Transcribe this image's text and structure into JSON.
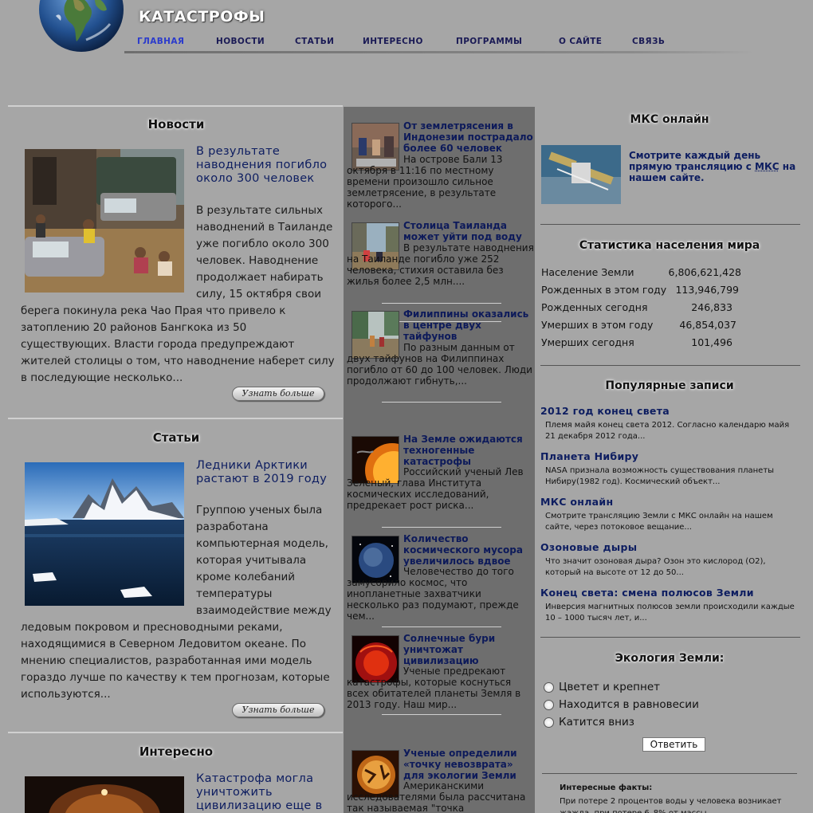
{
  "site": {
    "title": "КАТАСТРОФЫ"
  },
  "nav": [
    {
      "label": "ГЛАВНАЯ",
      "active": true
    },
    {
      "label": "НОВОСТИ"
    },
    {
      "label": "СТАТЬИ"
    },
    {
      "label": "ИНТЕРЕСНО"
    },
    {
      "label": "ПРОГРАММЫ"
    },
    {
      "label": "О САЙТЕ"
    },
    {
      "label": "СВЯЗЬ"
    }
  ],
  "main": {
    "news": {
      "heading": "Новости",
      "headline": "В результате наводнения погибло около 300 человек",
      "body_top": "В результате сильных наводнений в Таиланде уже погибло около 300 человек. Наводнение продолжает набирать силу, 15 октября свои",
      "body_bottom": "берега покинула река Чао Прая что привело к затоплению 20 районов Бангкока из 50 существующих. Власти города предупреждают жителей столицы о том, что наводнение наберет силу в последующие несколько...",
      "more": "Узнать больше"
    },
    "articles": {
      "heading": "Статьи",
      "headline": "Ледники Арктики растают в 2019 году",
      "body_top": "Группою ученых была разработана компьютерная модель, которая учитывала кроме колебаний температуры взаимодействие между",
      "body_bottom": "ледовым покровом и пресноводными реками, находящимися в Северном Ледовитом океане. По мнению специалистов, разработанная ими модель гораздо лучше по качеству к тем прогнозам, которые используются...",
      "more": "Узнать больше"
    },
    "interesting": {
      "heading": "Интересно",
      "headline": "Катастрофа могла уничтожить цивилизацию еще в"
    }
  },
  "mid": [
    {
      "title": "От землетрясения в Индонезии пострадало более 60 человек",
      "text": "На острове Бали 13 октября в 11:16 по местному времени произошло сильное землетрясение, в результате которого..."
    },
    {
      "title": "Столица Таиланда может уйти под воду",
      "text": "В результате наводнения на Таиланде погибло уже 252 человека, стихия оставила без жилья более 2,5 млн...."
    },
    {
      "title": "Филиппины оказались в центре двух тайфунов",
      "text": "По разным данным от двух тайфунов на Филиппинах погибло от 60 до 100 человек. Люди продолжают гибнуть,..."
    },
    {
      "title": "На Земле ожидаются техногенные катастрофы",
      "text": "Российский ученый Лев Зеленый, глава Института космических исследований, предрекает рост риска..."
    },
    {
      "title": "Количество космического мусора увеличилось вдвое",
      "text": "Человечество до того замусорило космос, что инопланетные захватчики несколько раз подумают, прежде чем..."
    },
    {
      "title": "Солнечные бури уничтожат цивилизацию",
      "text": "Ученые предрекают катастрофы, которые коснуться всех обитателей планеты Земля в 2013 году. Наш мир..."
    },
    {
      "title": "Ученые определили «точку невозврата» для экологии Земли",
      "text": "Американскими исследователями была рассчитана так называемая \"точка"
    }
  ],
  "right": {
    "iss": {
      "heading": "МКС онлайн",
      "text_before": "Смотрите каждый день прямую трансляцию с ",
      "text_link": "МКС",
      "text_after": " на нашем сайте."
    },
    "stats": {
      "heading": "Статистика населения мира",
      "rows": [
        {
          "label": "Население Земли",
          "value": "6,806,621,428"
        },
        {
          "label": "Рожденных в этом году",
          "value": "113,946,799"
        },
        {
          "label": "Рожденных сегодня",
          "value": "246,833"
        },
        {
          "label": "Умерших в этом году",
          "value": "46,854,037"
        },
        {
          "label": "Умерших сегодня",
          "value": "101,496"
        }
      ]
    },
    "popular": {
      "heading": "Популярные записи",
      "items": [
        {
          "title": "2012 год конец света",
          "text": "Племя майя конец света 2012. Согласно календарю майя 21 декабря 2012 года..."
        },
        {
          "title": "Планета Нибиру",
          "text": "NASA признала возможность существования планеты Нибиру(1982 год). Космический объект..."
        },
        {
          "title": "МКС онлайн",
          "text": "Смотрите трансляцию Земли с МКС онлайн на нашем сайте, через потоковое вещание..."
        },
        {
          "title": "Озоновые дыры",
          "text": "Что значит озоновая дыра? Озон это кислород (О2), который на высоте от 12 до 50..."
        },
        {
          "title": "Конец света: смена полюсов Земли",
          "text": "Инверсия магнитных полюсов земли происходили каждые 10 – 1000 тысяч лет, и..."
        }
      ]
    },
    "poll": {
      "heading": "Экология Земли:",
      "options": [
        "Цветет и крепнет",
        "Находится в равновесии",
        "Катится вниз"
      ],
      "button": "Ответить"
    },
    "facts": {
      "title": "Интересные факты:",
      "text": "При потере 2 процентов воды у человека возникает жажда, при потере 6–8% от массы"
    }
  }
}
